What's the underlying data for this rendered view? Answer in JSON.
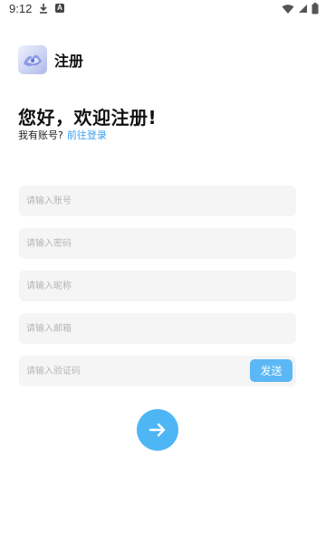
{
  "status_bar": {
    "time": "9:12",
    "icons": [
      "download-icon",
      "a-notification-icon",
      "wifi-icon",
      "signal-icon",
      "battery-icon"
    ]
  },
  "header": {
    "title": "注册",
    "logo_icon": "app-logo-icon"
  },
  "greeting": {
    "title": "您好，欢迎注册!",
    "have_account": "我有账号?",
    "login_link": "前往登录"
  },
  "form": {
    "account_placeholder": "请输入账号",
    "password_placeholder": "请输入密码",
    "nickname_placeholder": "请输入昵称",
    "email_placeholder": "请输入邮箱",
    "code_placeholder": "请输入验证码",
    "send_label": "发送",
    "submit_icon": "arrow-right-icon"
  },
  "colors": {
    "accent": "#4fb6f5",
    "link": "#3aa0f2",
    "field_bg": "#f5f5f5",
    "placeholder": "#b6b6b6"
  }
}
